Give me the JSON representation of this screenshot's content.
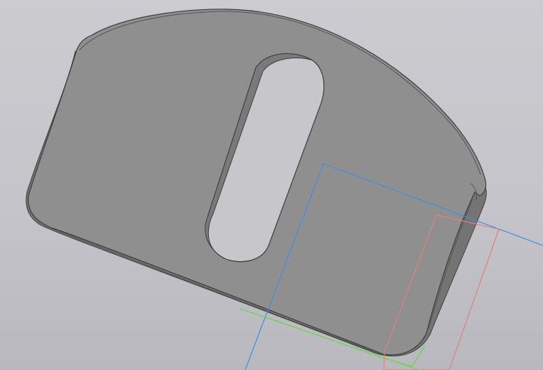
{
  "viewport": {
    "background_top": "#cbcbd0",
    "background_bottom": "#b8b8be"
  },
  "part": {
    "kind": "flat plate with slot",
    "face_color": "#8f8f8f",
    "side_color": "#747474",
    "edge_color": "#3d3d3d",
    "highlight_color": "#a8a8a8"
  },
  "planes": [
    {
      "name": "blue-plane",
      "color": "#3f8fe0"
    },
    {
      "name": "red-plane",
      "color": "#e08080"
    },
    {
      "name": "green-plane",
      "color": "#6ad84a"
    }
  ]
}
